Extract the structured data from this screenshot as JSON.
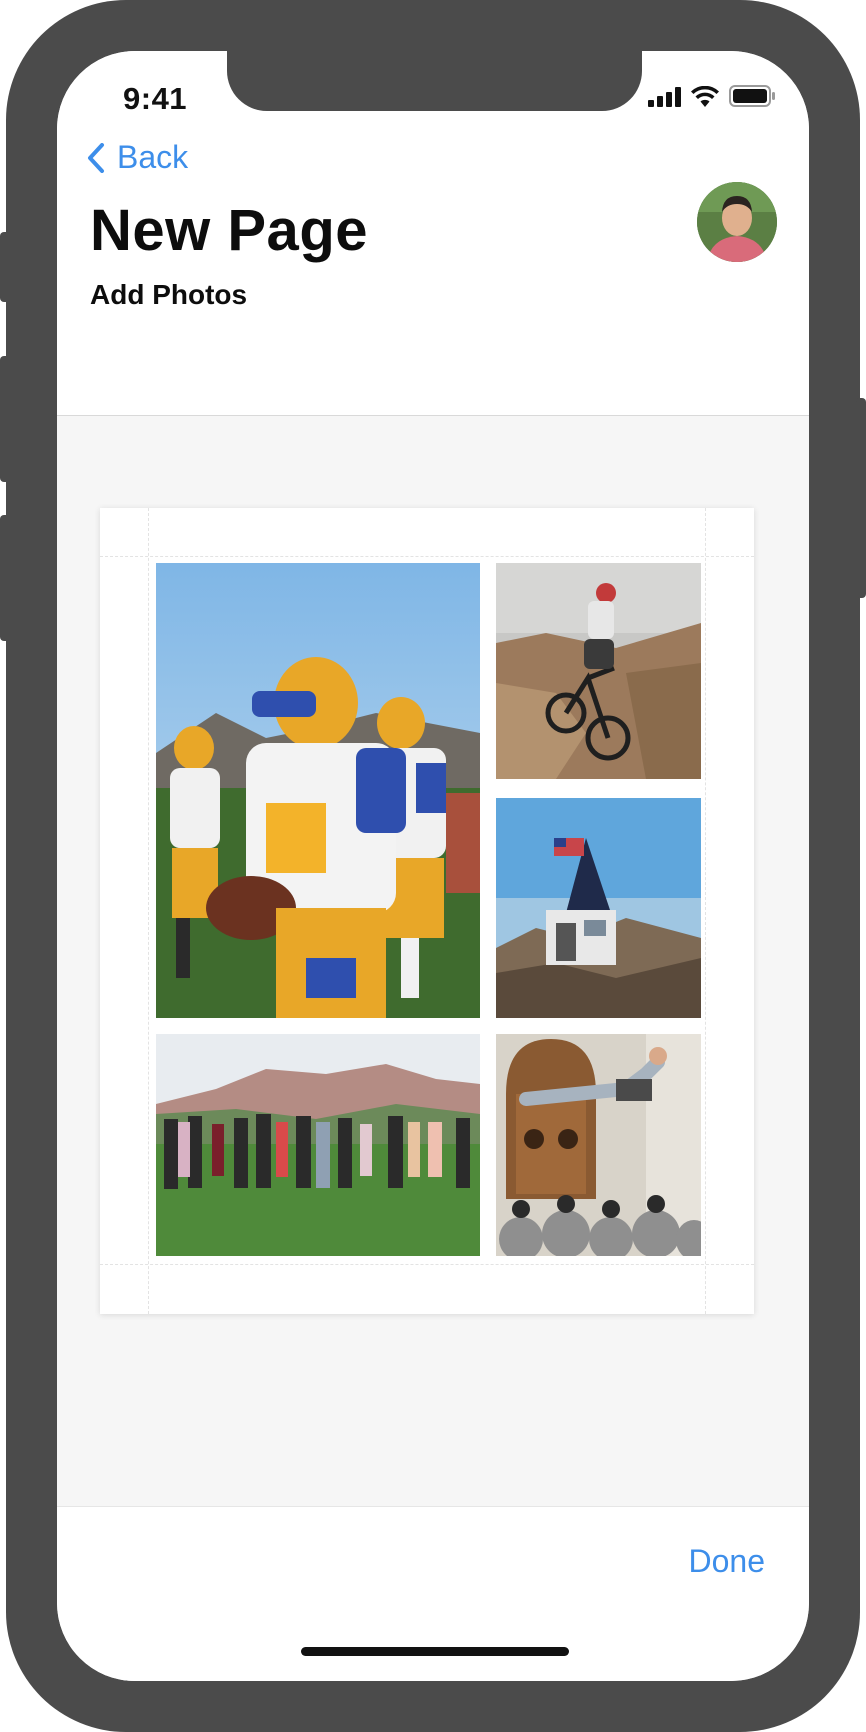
{
  "status_bar": {
    "time": "9:41",
    "icons": [
      "cellular-signal-icon",
      "wifi-icon",
      "battery-icon"
    ]
  },
  "nav": {
    "back_label": "Back",
    "title": "New Page",
    "subtitle": "Add Photos",
    "avatar_icon": "user-avatar"
  },
  "canvas": {
    "photos": [
      {
        "id": "football",
        "subject": "football-players-photo"
      },
      {
        "id": "biker",
        "subject": "mountain-biker-photo"
      },
      {
        "id": "summit",
        "subject": "mountain-summit-hut-photo"
      },
      {
        "id": "group",
        "subject": "group-formal-photo"
      },
      {
        "id": "wedding",
        "subject": "groom-toss-photo"
      }
    ]
  },
  "footer": {
    "done_label": "Done"
  },
  "colors": {
    "accent": "#3d8eea",
    "frame": "#4b4b4b",
    "background": "#f6f6f6"
  }
}
